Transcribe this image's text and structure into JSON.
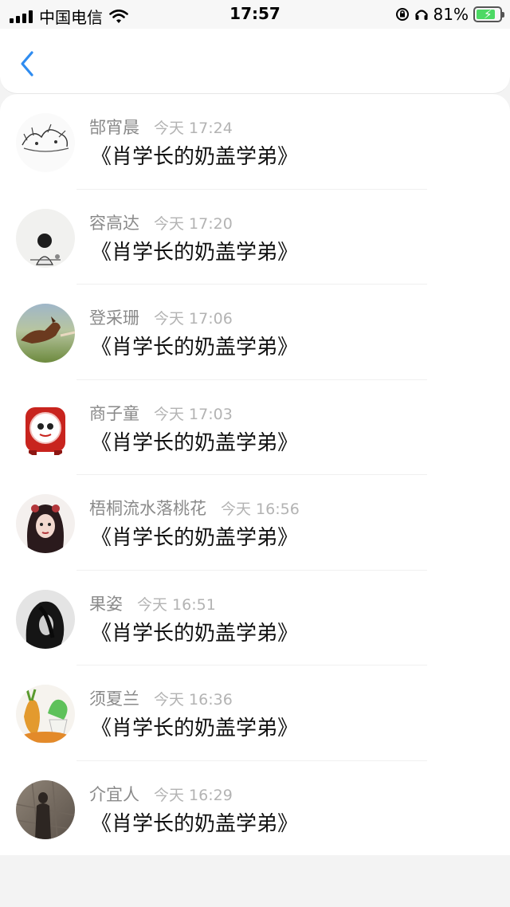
{
  "status": {
    "carrier": "中国电信",
    "time": "17:57",
    "battery": "81%"
  },
  "nav": {
    "back_icon": "chevron-left-icon",
    "accent": "#2f8cf0"
  },
  "items": [
    {
      "name": "郜宵晨",
      "time": "今天 17:24",
      "book": "《肖学长的奶盖学弟》"
    },
    {
      "name": "容高达",
      "time": "今天 17:20",
      "book": "《肖学长的奶盖学弟》"
    },
    {
      "name": "登采珊",
      "time": "今天 17:06",
      "book": "《肖学长的奶盖学弟》"
    },
    {
      "name": "商子童",
      "time": "今天 17:03",
      "book": "《肖学长的奶盖学弟》"
    },
    {
      "name": "梧桐流水落桃花",
      "time": "今天 16:56",
      "book": "《肖学长的奶盖学弟》"
    },
    {
      "name": "果姿",
      "time": "今天 16:51",
      "book": "《肖学长的奶盖学弟》"
    },
    {
      "name": "须夏兰",
      "time": "今天 16:36",
      "book": "《肖学长的奶盖学弟》"
    },
    {
      "name": "介宜人",
      "time": "今天 16:29",
      "book": "《肖学长的奶盖学弟》"
    }
  ]
}
